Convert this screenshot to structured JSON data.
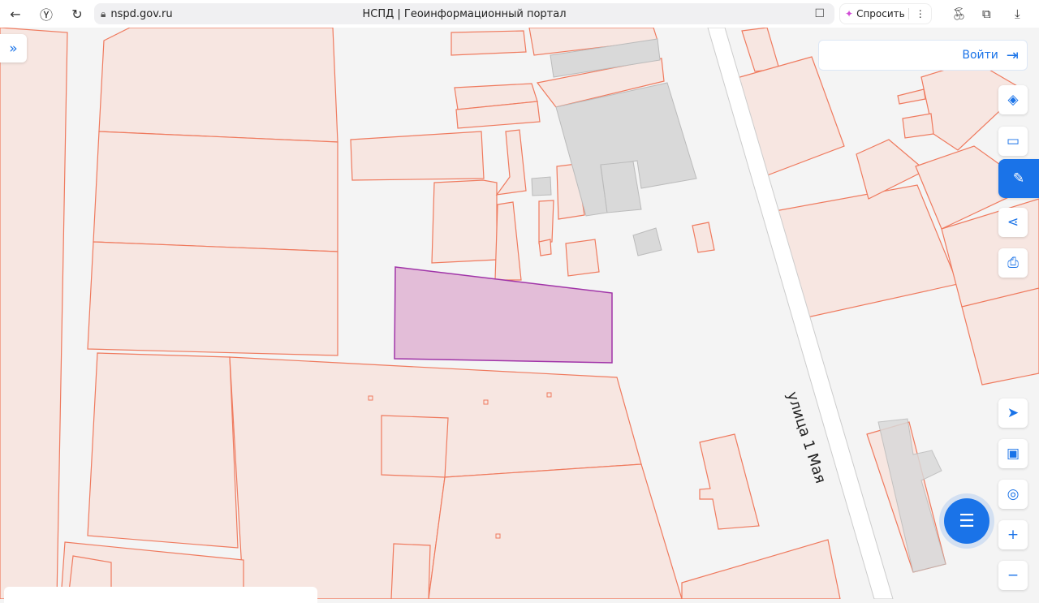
{
  "browser": {
    "url": "nspd.gov.ru",
    "tab_title": "НСПД | Геоинформационный портал",
    "ask_label": "Спросить"
  },
  "map": {
    "street_label": "улица 1 Мая",
    "selected_color": "#e3bdd8",
    "parcel_fill": "#f7e6e1",
    "parcel_stroke": "#ef7a5e",
    "building_fill": "#d9d9d9"
  },
  "header": {
    "login_label": "Войти"
  },
  "accent": "#1a73e8"
}
